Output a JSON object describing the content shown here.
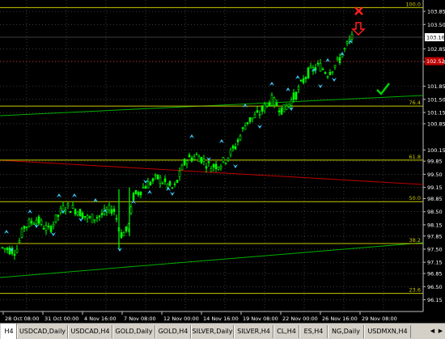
{
  "price_axis": {
    "ticks": [
      "103.85",
      "103.50",
      "102.85",
      "102.50",
      "101.85",
      "101.50",
      "101.15",
      "100.85",
      "100.15",
      "99.85",
      "99.50",
      "99.15",
      "98.85",
      "98.50",
      "98.15",
      "97.85",
      "97.50",
      "97.15",
      "96.85",
      "96.50",
      "96.15"
    ],
    "current_price": "103.16",
    "ask_price": "102.52"
  },
  "time_axis": {
    "labels": [
      "28 Oct 08:00",
      "31 Oct 00:00",
      "4 Nov 16:00",
      "7 Nov 08:00",
      "12 Nov 00:00",
      "14 Nov 16:00",
      "19 Nov 08:00",
      "22 Nov 00:00",
      "26 Nov 16:00",
      "29 Nov 08:00"
    ]
  },
  "fib_levels": [
    {
      "label": "100.0",
      "price": 103.95
    },
    {
      "label": "76.4",
      "price": 101.32
    },
    {
      "label": "61.8",
      "price": 99.88
    },
    {
      "label": "50.0",
      "price": 98.77
    },
    {
      "label": "38.2",
      "price": 97.65
    },
    {
      "label": "23.6",
      "price": 96.32
    }
  ],
  "tabs": [
    {
      "label": "H4",
      "active": true
    },
    {
      "label": "USDCAD,Daily",
      "active": false
    },
    {
      "label": "USDCAD,H4",
      "active": false
    },
    {
      "label": "GOLD,Daily",
      "active": false
    },
    {
      "label": "GOLD,H4",
      "active": false
    },
    {
      "label": "SILVER,Daily",
      "active": false
    },
    {
      "label": "SILVER,H4",
      "active": false
    },
    {
      "label": "CL,H4",
      "active": false
    },
    {
      "label": "ES,H4",
      "active": false
    },
    {
      "label": "NG,Daily",
      "active": false
    },
    {
      "label": "USDMXN,H4",
      "active": false
    }
  ],
  "colors": {
    "background": "#000000",
    "candles": "#00ff00",
    "fib": "#c8c800",
    "grid": "#606060",
    "up_arrow": "#3cc8ff",
    "trend_red": "#c00000",
    "trend_green": "#00b000",
    "sell_mark": "#ff2020",
    "check_mark": "#00d000"
  },
  "icons": {
    "tab_left": "triangle-left-icon",
    "tab_right": "triangle-right-icon",
    "sell_signal": "x-mark-icon",
    "down_signal": "down-arrow-icon",
    "confirm": "check-mark-icon"
  }
}
